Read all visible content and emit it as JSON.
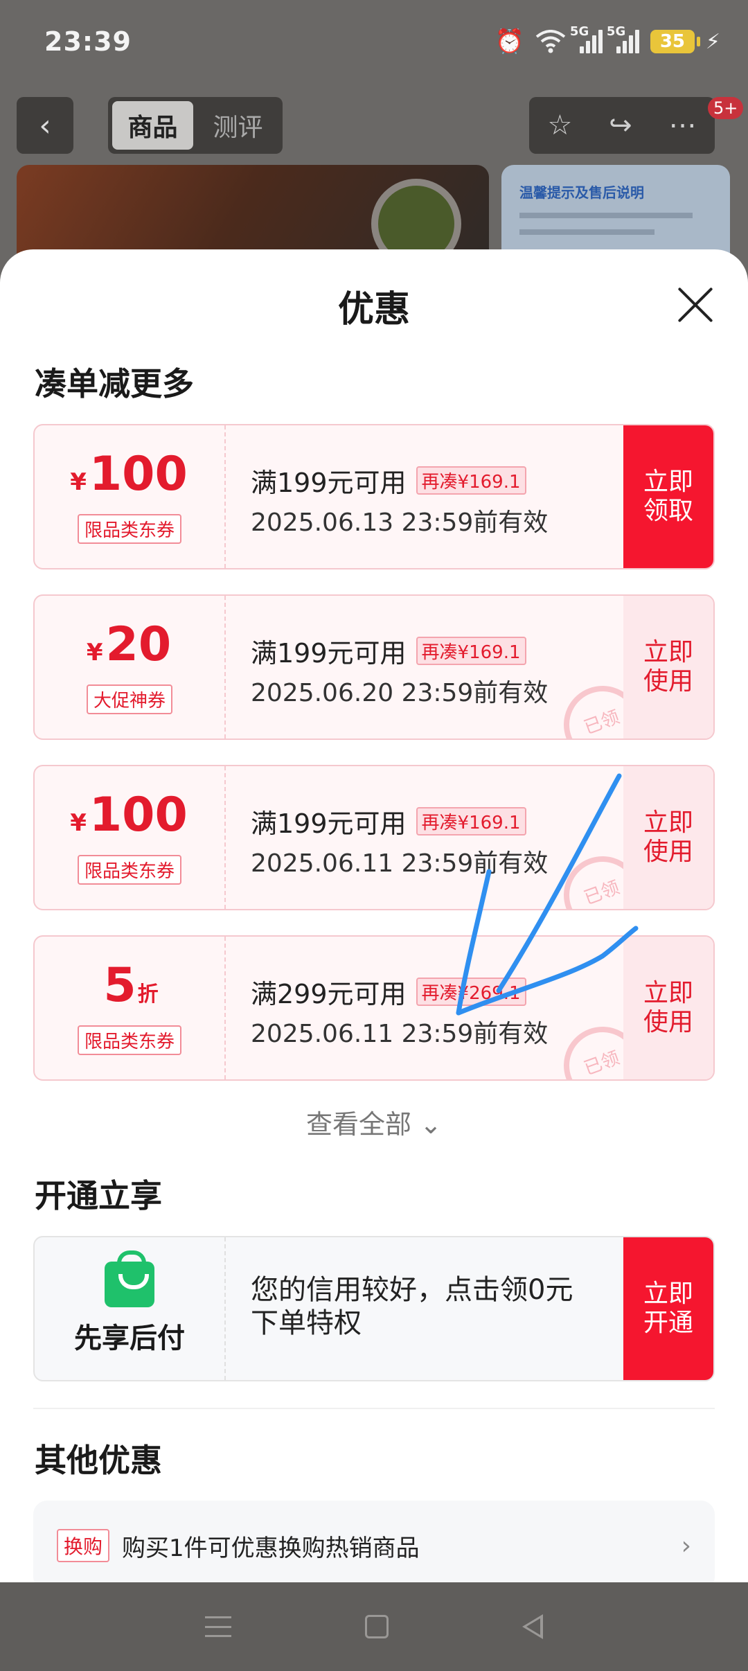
{
  "status_bar": {
    "time": "23:39",
    "battery": "35",
    "network": "5G"
  },
  "background_page": {
    "tabs": [
      "商品",
      "测评"
    ],
    "cart_badge": "5+",
    "banner_title": "温馨提示及售后说明"
  },
  "sheet": {
    "title": "优惠",
    "section_coupons": "凑单减更多",
    "coupons": [
      {
        "currency": "¥",
        "amount": "100",
        "unit": "",
        "tag": "限品类东券",
        "condition": "满199元可用",
        "extra": "再凑¥169.1",
        "validity": "2025.06.13 23:59前有效",
        "action": "立即\n领取",
        "claimed": false
      },
      {
        "currency": "¥",
        "amount": "20",
        "unit": "",
        "tag": "大促神券",
        "condition": "满199元可用",
        "extra": "再凑¥169.1",
        "validity": "2025.06.20 23:59前有效",
        "action": "立即\n使用",
        "claimed": true
      },
      {
        "currency": "¥",
        "amount": "100",
        "unit": "",
        "tag": "限品类东券",
        "condition": "满199元可用",
        "extra": "再凑¥169.1",
        "validity": "2025.06.11 23:59前有效",
        "action": "立即\n使用",
        "claimed": true
      },
      {
        "currency": "",
        "amount": "5",
        "unit": "折",
        "tag": "限品类东券",
        "condition": "满299元可用",
        "extra": "再凑¥269.1",
        "validity": "2025.06.11 23:59前有效",
        "action": "立即\n使用",
        "claimed": true
      }
    ],
    "claimed_stamp": "已领",
    "view_all": "查看全部 ⌄",
    "section_open": "开通立享",
    "credit": {
      "label": "先享后付",
      "desc": "您的信用较好，点击领0元下单特权",
      "action": "立即\n开通"
    },
    "section_other": "其他优惠",
    "other": {
      "tag": "换购",
      "text": "购买1件可优惠换购热销商品",
      "chevron": "›"
    }
  }
}
